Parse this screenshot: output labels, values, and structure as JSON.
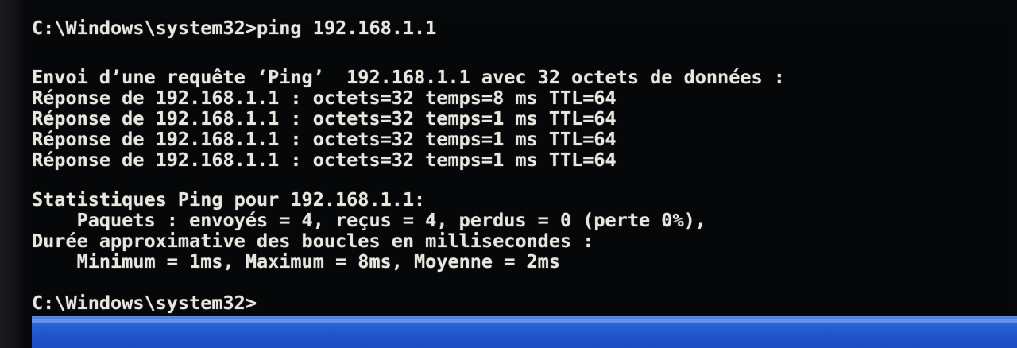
{
  "console": {
    "lines": [
      "C:\\Windows\\system32>ping 192.168.1.1",
      "",
      "Envoi d’une requête ‘Ping’  192.168.1.1 avec 32 octets de données :",
      "Réponse de 192.168.1.1 : octets=32 temps=8 ms TTL=64",
      "Réponse de 192.168.1.1 : octets=32 temps=1 ms TTL=64",
      "Réponse de 192.168.1.1 : octets=32 temps=1 ms TTL=64",
      "Réponse de 192.168.1.1 : octets=32 temps=1 ms TTL=64",
      "",
      "Statistiques Ping pour 192.168.1.1:",
      "    Paquets : envoyés = 4, reçus = 4, perdus = 0 (perte 0%),",
      "Durée approximative des boucles en millisecondes :",
      "    Minimum = 1ms, Maximum = 8ms, Moyenne = 2ms",
      "",
      "C:\\Windows\\system32>"
    ]
  },
  "colors": {
    "console_background": "#060709",
    "console_text": "#e8e6df",
    "taskbar": "#1f54cd"
  }
}
